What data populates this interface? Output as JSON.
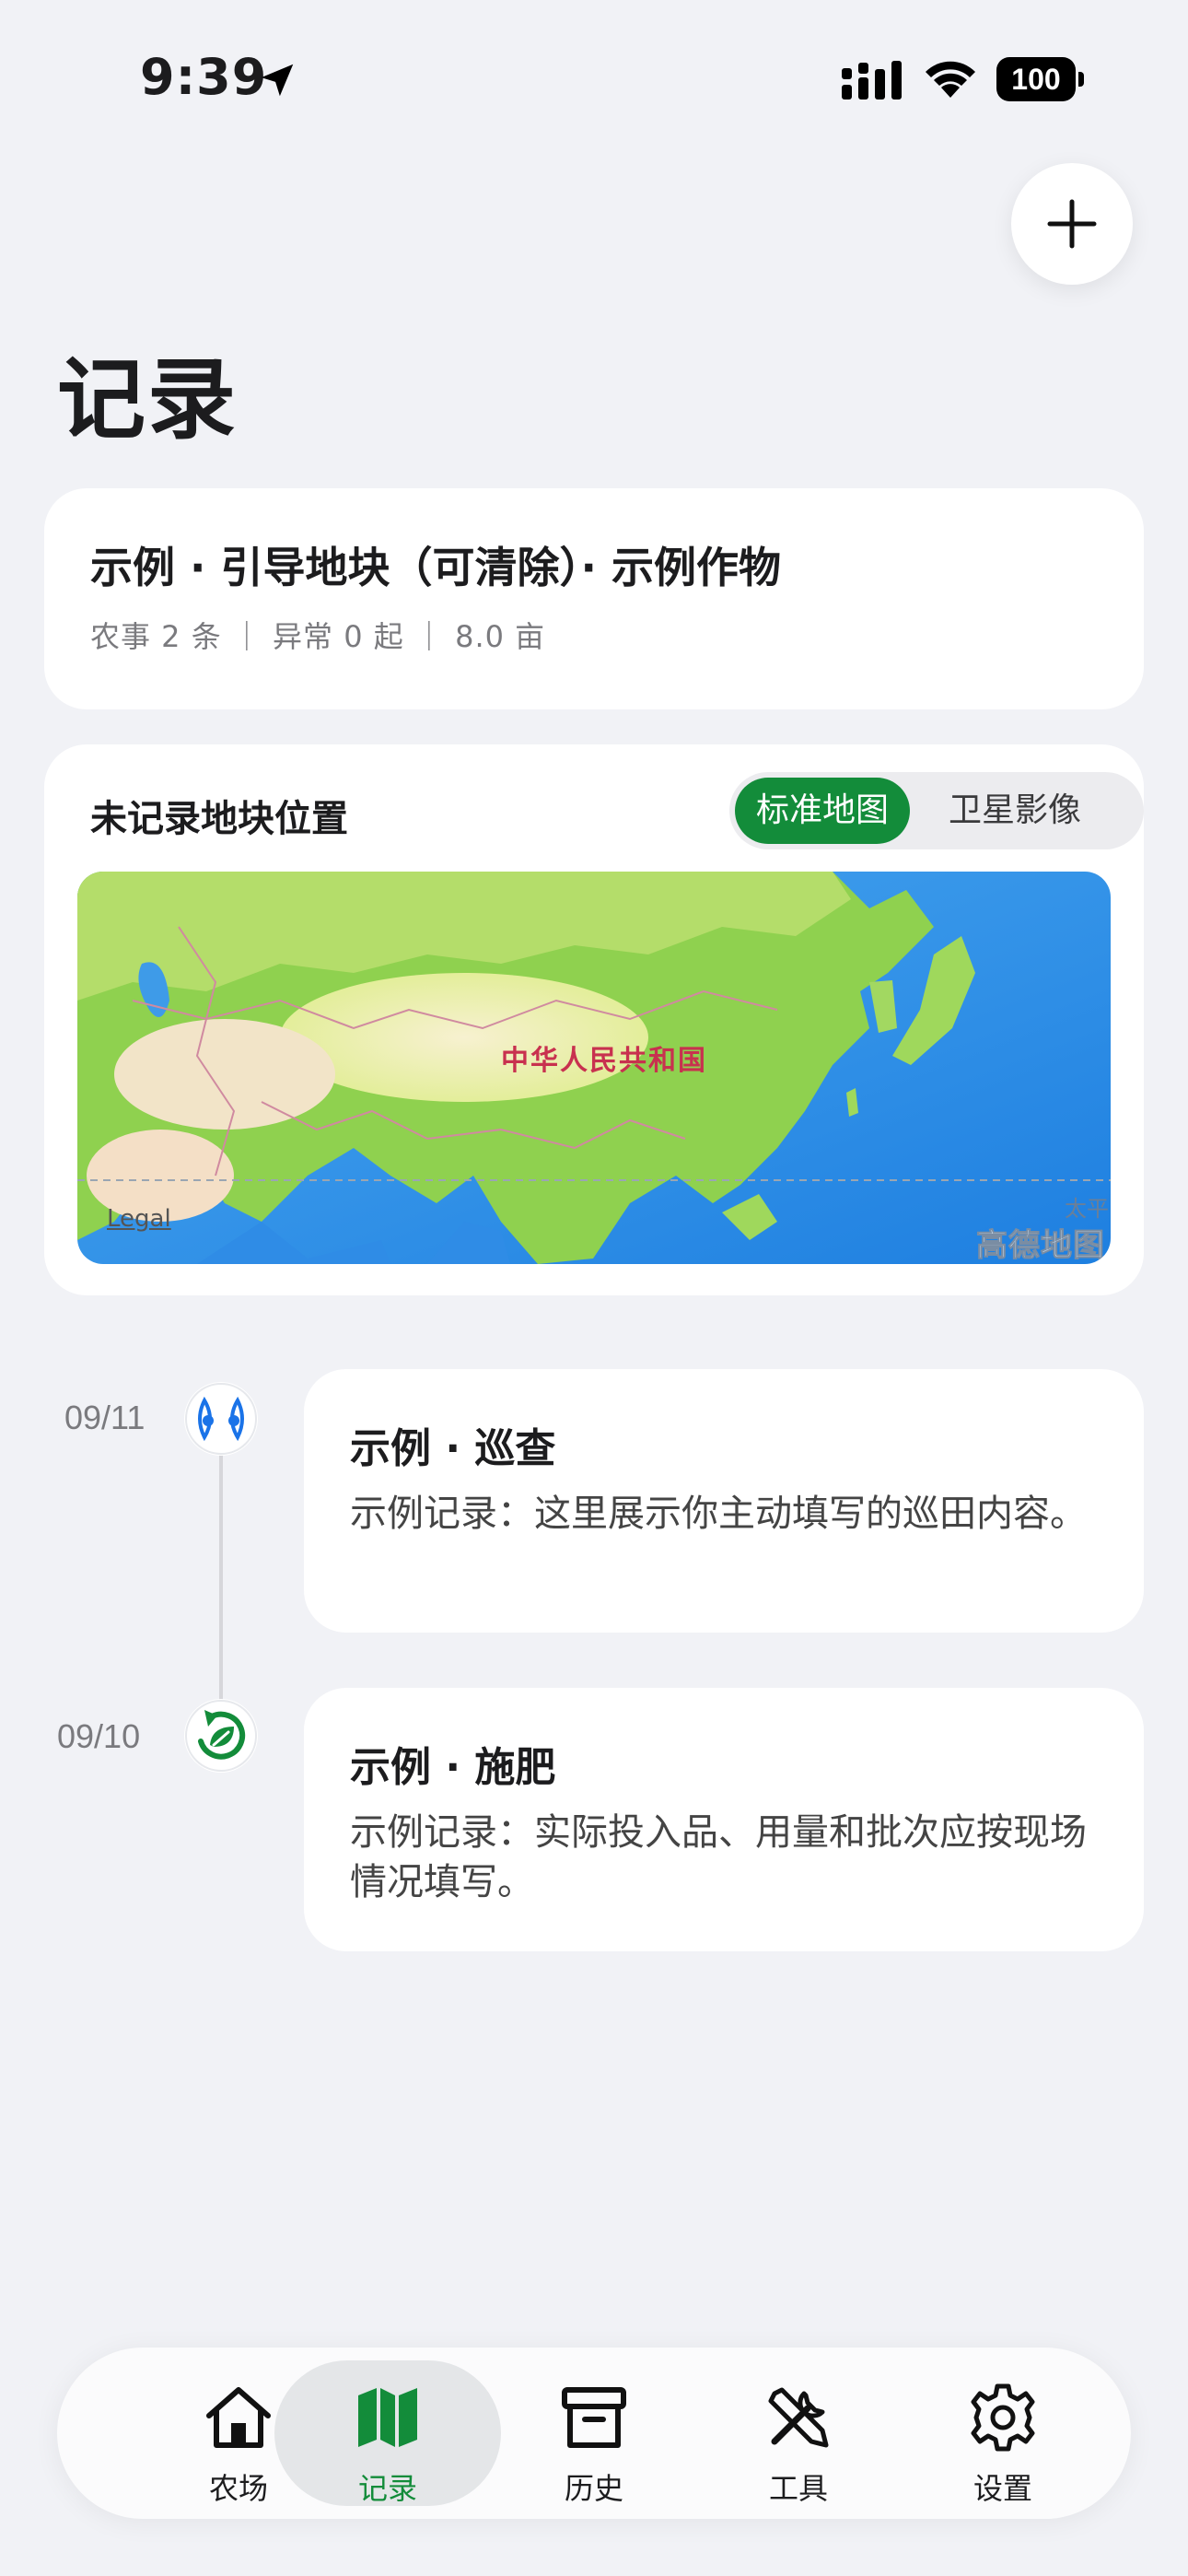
{
  "status_bar": {
    "time": "9:39",
    "battery": "100"
  },
  "header": {
    "title": "记录",
    "add_icon": "plus-icon"
  },
  "summary": {
    "title": "示例 · 引导地块（可清除）· 示例作物",
    "meta": "农事 2 条 ｜ 异常 0 起 ｜ 8.0 亩"
  },
  "map_card": {
    "heading": "未记录地块位置",
    "toggle": {
      "standard": "标准地图",
      "satellite": "卫星影像",
      "selected": "standard"
    },
    "country_label": "中华人民共和国",
    "legal": "Legal",
    "ocean_label": "太平",
    "logo": "高德地图"
  },
  "timeline": {
    "items": [
      {
        "date": "09/11",
        "icon": "eyes-icon",
        "title": "示例 · 巡查",
        "description": "示例记录：这里展示你主动填写的巡田内容。"
      },
      {
        "date": "09/10",
        "icon": "fertilize-icon",
        "title": "示例 · 施肥",
        "description": "示例记录：实际投入品、用量和批次应按现场情况填写。"
      }
    ]
  },
  "tab_bar": {
    "active": "records",
    "tabs": [
      {
        "id": "farm",
        "label": "农场",
        "icon": "house-icon"
      },
      {
        "id": "records",
        "label": "记录",
        "icon": "map-icon"
      },
      {
        "id": "history",
        "label": "历史",
        "icon": "archive-icon"
      },
      {
        "id": "tools",
        "label": "工具",
        "icon": "tools-icon"
      },
      {
        "id": "settings",
        "label": "设置",
        "icon": "gear-icon"
      }
    ]
  },
  "colors": {
    "accent": "#138c3a",
    "background": "#f1f2f6",
    "card": "#ffffff",
    "map_label": "#c8314f"
  }
}
